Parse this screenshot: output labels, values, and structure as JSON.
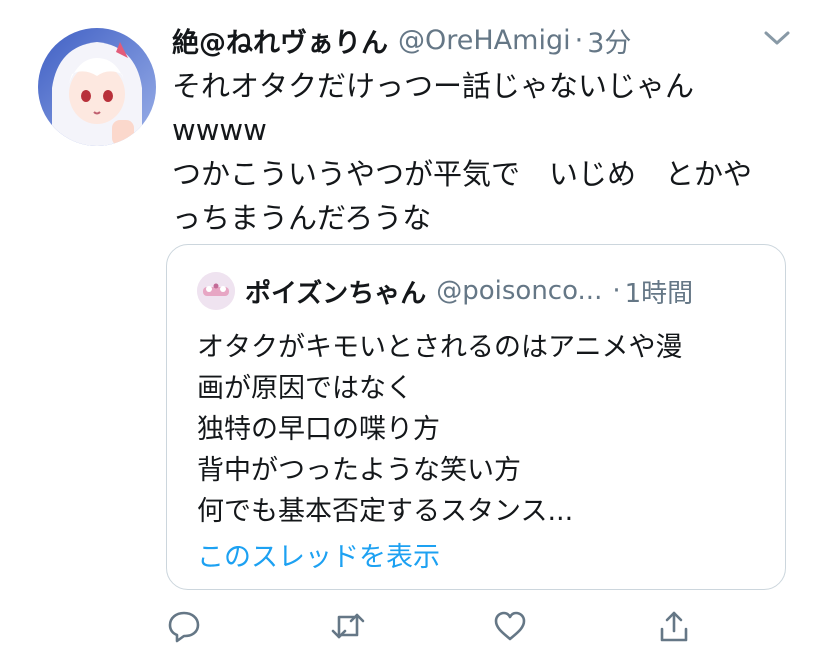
{
  "tweet": {
    "display_name": "絶@ねれヴぁりん",
    "handle": "@OreHAmigi",
    "separator": "·",
    "time": "3分",
    "lines": [
      "それオタクだけっつー話じゃないじゃん",
      "wwww",
      "つかこういうやつが平気で　いじめ　とかや",
      "っちまうんだろうな"
    ]
  },
  "quoted": {
    "display_name": "ポイズンちゃん",
    "handle": "@poisonco...",
    "separator": "·",
    "time": "1時間",
    "lines": [
      "オタクがキモいとされるのはアニメや漫",
      "画が原因ではなく",
      "独特の早口の喋り方",
      "背中がつったような笑い方",
      "何でも基本否定するスタンス..."
    ],
    "thread_link": "このスレッドを表示"
  },
  "actions": {
    "icons": [
      "reply-icon",
      "retweet-icon",
      "like-icon",
      "share-icon"
    ]
  },
  "colors": {
    "text": "#14171a",
    "secondary": "#657786",
    "link": "#1da1f2",
    "border": "#ccd6dd"
  }
}
